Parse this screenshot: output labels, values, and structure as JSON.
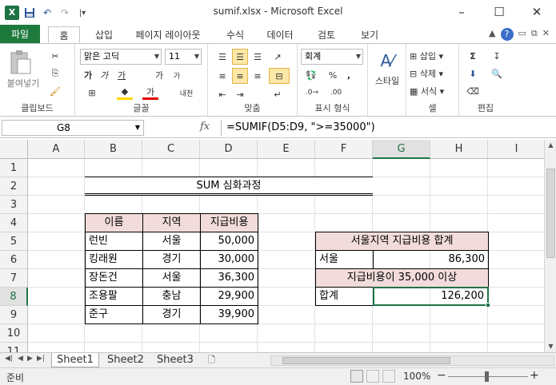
{
  "window": {
    "title": "sumif.xlsx - Microsoft Excel",
    "minimize": "–",
    "maximize": "☐",
    "close": "✕"
  },
  "qat": {
    "excel_logo": "X",
    "save": "💾",
    "undo": "↶",
    "redo": "↷",
    "customize": "|▾"
  },
  "tabs": [
    "파일",
    "홈",
    "삽입",
    "페이지 레이아웃",
    "수식",
    "데이터",
    "검토",
    "보기"
  ],
  "ribbon": {
    "clipboard": {
      "paste": "붙여넣기",
      "label": "클립보드"
    },
    "font": {
      "name": "맑은 고딕",
      "size": "11",
      "bold": "가",
      "italic": "가",
      "underline": "가",
      "grow": "가",
      "shrink": "가",
      "label": "글꼴",
      "phonetic": "내천"
    },
    "alignment": {
      "label": "맞춤"
    },
    "number": {
      "format": "회계",
      "percent": "%",
      "comma": ",",
      "label": "표시 형식"
    },
    "styles": {
      "button": "스타일"
    },
    "cells": {
      "insert": "삽입",
      "delete": "삭제",
      "format": "서식",
      "label": "셀"
    },
    "editing": {
      "sum": "Σ",
      "label": "편집"
    }
  },
  "formula_bar": {
    "name_box": "G8",
    "fx": "fx",
    "formula": "=SUMIF(D5:D9, \">=35000\")"
  },
  "columns": [
    "A",
    "B",
    "C",
    "D",
    "E",
    "F",
    "G",
    "H",
    "I"
  ],
  "rows": [
    "1",
    "2",
    "3",
    "4",
    "5",
    "6",
    "7",
    "8",
    "9",
    "10",
    "11"
  ],
  "sheet": {
    "title": "SUM 심화과정",
    "headers": [
      "이름",
      "지역",
      "지급비용"
    ],
    "data": [
      [
        "런빈",
        "서울",
        "50,000"
      ],
      [
        "킹래원",
        "경기",
        "30,000"
      ],
      [
        "장돈건",
        "서울",
        "36,300"
      ],
      [
        "조용팔",
        "충남",
        "29,900"
      ],
      [
        "준구",
        "경기",
        "39,900"
      ]
    ],
    "summary1_title": "서울지역 지급비용 합계",
    "summary1_label": "서울",
    "summary1_value": "86,300",
    "summary2_title": "지급비용이 35,000 이상",
    "summary2_label": "합계",
    "summary2_value": "126,200"
  },
  "sheet_tabs": [
    "Sheet1",
    "Sheet2",
    "Sheet3"
  ],
  "status": {
    "ready": "준비",
    "zoom": "100%",
    "minus": "−",
    "plus": "+"
  }
}
